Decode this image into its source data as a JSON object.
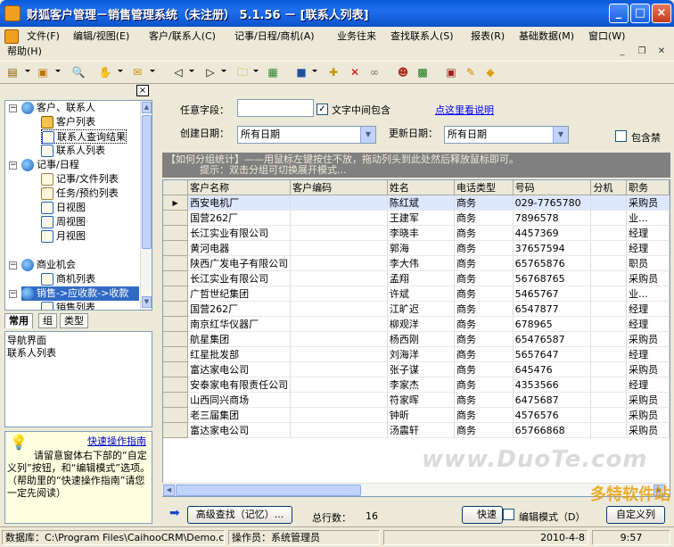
{
  "window": {
    "title": "财狐客户管理－销售管理系统（未注册） 5.1.56 － [联系人列表]"
  },
  "menu": {
    "items": [
      "文件(F)",
      "编辑/视图(E)",
      "客户/联系人(C)",
      "记事/日程/商机(A)",
      "业务往来",
      "查找联系人(S)",
      "报表(R)",
      "基础数据(M)",
      "窗口(W)"
    ],
    "help": "帮助(H)"
  },
  "toolbar": {
    "icons": [
      "list-icon",
      "card-icon",
      "find-icon",
      "handshake-icon",
      "mail-icon",
      "prev-icon",
      "next-icon",
      "folder-icon",
      "doc-icon",
      "save-icon",
      "new-icon",
      "delete-icon",
      "link-icon",
      "people-icon",
      "excel-icon",
      "calendar-icon",
      "note-icon",
      "diamond-icon"
    ]
  },
  "left": {
    "close": "×",
    "tree": {
      "n1": "客户、联系人",
      "n1a": "客户列表",
      "n1b": "联系人查询结果",
      "n1c": "联系人列表",
      "n2": "记事/日程",
      "n2a": "记事/文件列表",
      "n2b": "任务/预约列表",
      "n2c": "日视图",
      "n2d": "周视图",
      "n2e": "月视图",
      "n3": "商业机会",
      "n3a": "商机列表",
      "n4": "销售->应收款->收款",
      "n4a": "销售列表"
    },
    "tabs": [
      "常用",
      "组",
      "类型"
    ],
    "nav": {
      "line1": "导航界面",
      "line2": "联系人列表"
    },
    "guide": {
      "link": "快速操作指南",
      "text": "请留意窗体右下部的“自定义列”按钮，和“编辑模式”选项。（帮助里的“快速操作指南”请您一定先阅读）"
    }
  },
  "filters": {
    "any_field_label": "任意字段：",
    "any_field_value": "",
    "contains_label": "文字中间包含",
    "contains_checked": "✓",
    "help_link": "点这里看说明",
    "created_label": "创建日期：",
    "created_value": "所有日期",
    "updated_label": "更新日期：",
    "updated_value": "所有日期",
    "include_deleted_label": "包含禁"
  },
  "groupbar": {
    "line1": "【如何分组统计】——用鼠标左键按住不放，拖动列头到此处然后释放鼠标即可。",
    "line2": "提示：双击分组可切换展开模式..."
  },
  "grid": {
    "columns": [
      "客户名称",
      "客户编码",
      "姓名",
      "电话类型",
      "号码",
      "分机",
      "职务"
    ],
    "rows": [
      [
        "西安电机厂",
        "",
        "陈红斌",
        "商务",
        "029-7765780",
        "",
        "采购员"
      ],
      [
        "国营262厂",
        "",
        "王建军",
        "商务",
        "7896578",
        "",
        "业..."
      ],
      [
        "长江实业有限公司",
        "",
        "李晓丰",
        "商务",
        "4457369",
        "",
        "经理"
      ],
      [
        "黄河电器",
        "",
        "郭海",
        "商务",
        "37657594",
        "",
        "经理"
      ],
      [
        "陕西广发电子有限公司",
        "",
        "李大伟",
        "商务",
        "65765876",
        "",
        "职员"
      ],
      [
        "长江实业有限公司",
        "",
        "孟翔",
        "商务",
        "56768765",
        "",
        "采购员"
      ],
      [
        "广哲世纪集团",
        "",
        "许斌",
        "商务",
        "5465767",
        "",
        "业..."
      ],
      [
        "国营262厂",
        "",
        "江旷迟",
        "商务",
        "6547877",
        "",
        "经理"
      ],
      [
        "南京红华仪器厂",
        "",
        "柳观洋",
        "商务",
        "678965",
        "",
        "经理"
      ],
      [
        "航星集团",
        "",
        "杨西刚",
        "商务",
        "65476587",
        "",
        "采购员"
      ],
      [
        "红星批发部",
        "",
        "刘海洋",
        "商务",
        "5657647",
        "",
        "经理"
      ],
      [
        "富达家电公司",
        "",
        "张子谋",
        "商务",
        "645476",
        "",
        "采购员"
      ],
      [
        "安泰家电有限责任公司",
        "",
        "李家杰",
        "商务",
        "4353566",
        "",
        "经理"
      ],
      [
        "山西同兴商场",
        "",
        "符家晖",
        "商务",
        "6475687",
        "",
        "采购员"
      ],
      [
        "老三届集团",
        "",
        "钟昕",
        "商务",
        "4576576",
        "",
        "采购员"
      ],
      [
        "富达家电公司",
        "",
        "汤震轩",
        "商务",
        "65766868",
        "",
        "采购员"
      ]
    ],
    "watermark": "www.DuoTe.com"
  },
  "bottom": {
    "adv_search": "高级查找（记忆）...",
    "total_label": "总行数：",
    "total_value": "16",
    "quick_label": "快速",
    "edit_mode_label": "编辑模式（D）",
    "custom_cols": "自定义列"
  },
  "status": {
    "db": "数据库：C:\\Program Files\\CaihooCRM\\Demo.cdb",
    "operator": "操作员：系统管理员",
    "date": "2010-4-8",
    "time": "9:57"
  },
  "brand": "多特软件站"
}
